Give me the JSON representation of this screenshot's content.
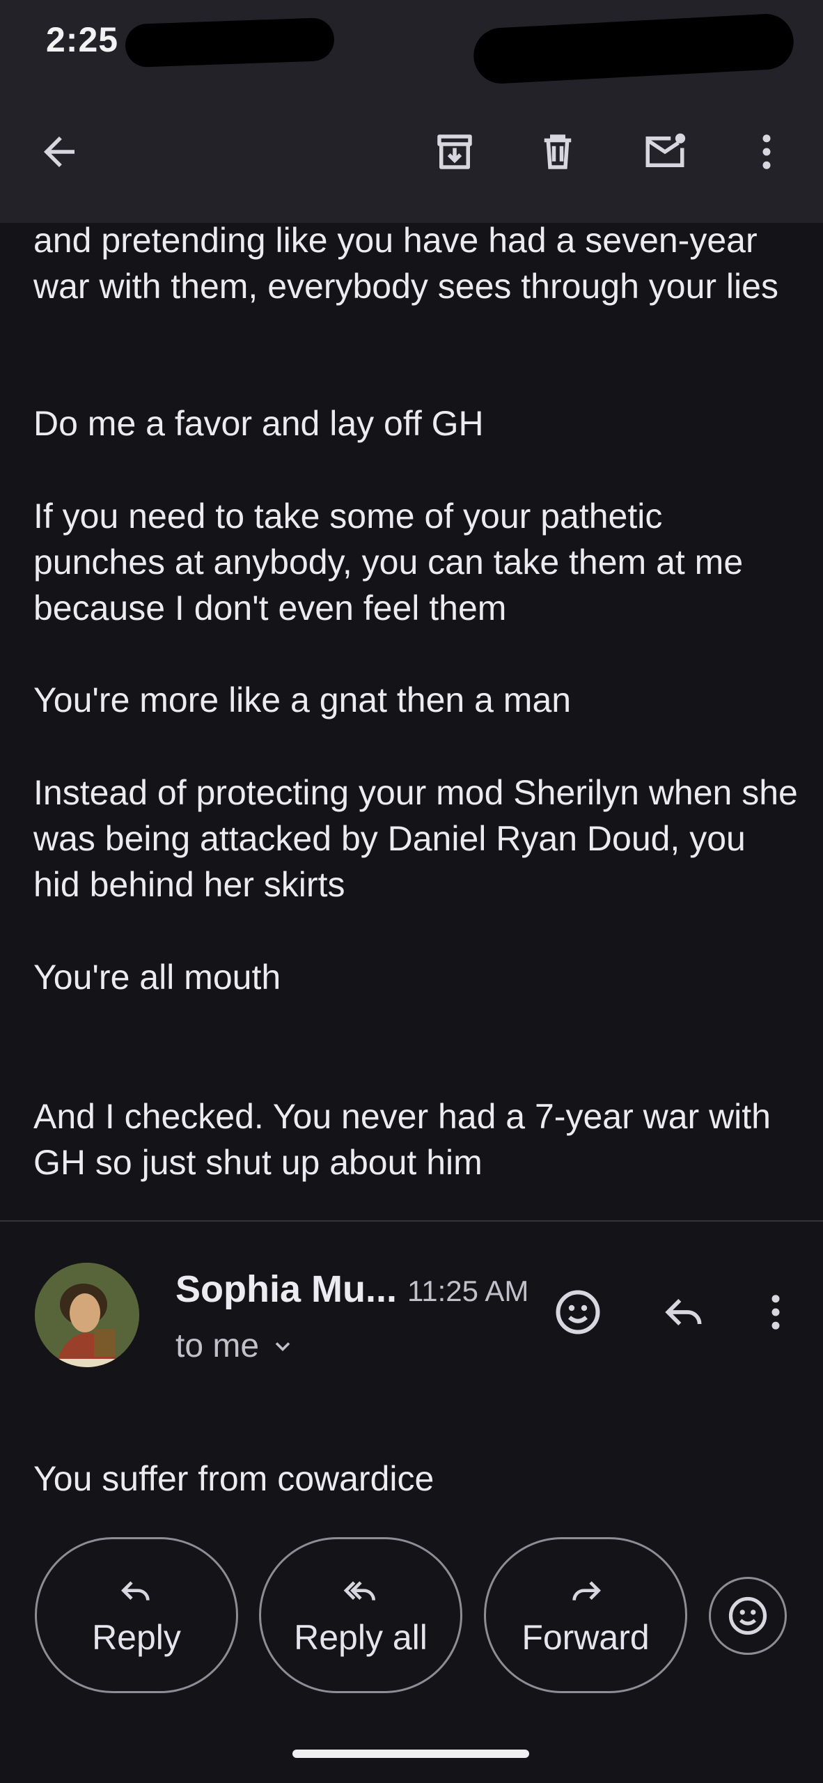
{
  "status_bar": {
    "time": "2:25"
  },
  "toolbar": {
    "back_icon": "arrow-back-icon",
    "archive_icon": "archive-icon",
    "delete_icon": "trash-icon",
    "mark_unread_icon": "mail-unread-icon",
    "more_icon": "more-vert-icon"
  },
  "previous_message": {
    "paragraphs": [
      "and pretending like you have had a seven-year war with them, everybody sees through your lies",
      "Do me a favor and lay off GH",
      "If you need to take some of your pathetic punches at anybody, you can take them at me because I don't even feel them",
      "You're more like a gnat then a man",
      "Instead of protecting your mod Sherilyn when she was being attacked by Daniel Ryan Doud, you hid behind her skirts",
      "You're all mouth",
      "And I checked. You never had a 7-year war with GH so just shut up about him"
    ]
  },
  "message": {
    "sender": "Sophia Mu...",
    "time": "11:25 AM",
    "recipient": "to me",
    "body": "You suffer from cowardice"
  },
  "actions": {
    "reply": "Reply",
    "reply_all": "Reply all",
    "forward": "Forward"
  },
  "colors": {
    "background": "#141318",
    "toolbar": "#232228",
    "text": "#ecebf1",
    "outline": "#8e8c95"
  }
}
